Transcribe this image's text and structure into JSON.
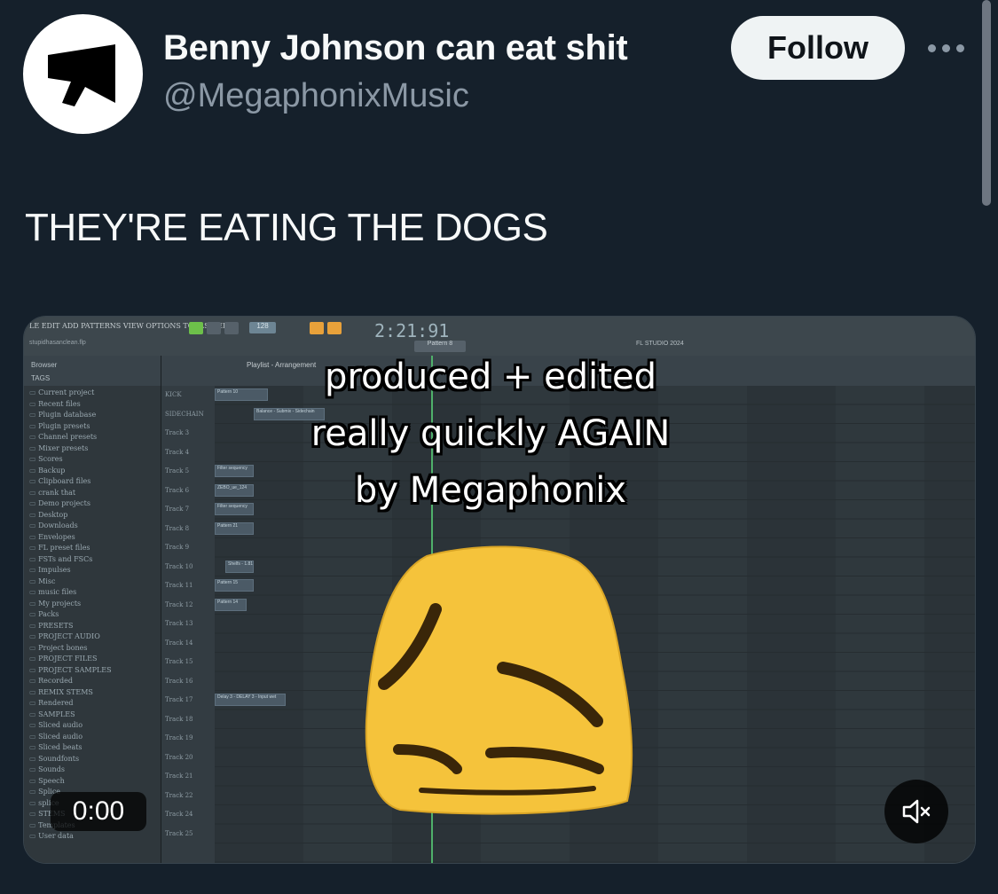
{
  "tweet": {
    "author": {
      "display_name": "Benny Johnson can eat shit",
      "handle": "@MegaphonixMusic",
      "avatar_icon": "megaphone-icon"
    },
    "follow_label": "Follow",
    "more_icon": "more-horizontal-icon",
    "text": "THEY'RE EATING THE DOGS"
  },
  "video": {
    "caption_lines": [
      "produced + edited",
      "really quickly AGAIN",
      "by Megaphonix"
    ],
    "time": "0:00",
    "mute_icon": "volume-muted-icon",
    "app": {
      "menu": "LE EDIT ADD PATTERNS VIEW OPTIONS TOOLS HELP",
      "project": "stupidhasanclean.flp",
      "time": "2:21:91",
      "bpm": "128",
      "pattern": "Pattern 8",
      "studio_tag": "FL STUDIO 2024",
      "playlist_title": "Playlist - Arrangement",
      "browser_head": "Browser",
      "browser_tags": "TAGS",
      "browser_items": [
        "Current project",
        "Recent files",
        "Plugin database",
        "Plugin presets",
        "Channel presets",
        "Mixer presets",
        "Scores",
        "Backup",
        "Clipboard files",
        "crank that",
        "Demo projects",
        "Desktop",
        "Downloads",
        "Envelopes",
        "FL preset files",
        "FSTs and FSCs",
        "Impulses",
        "Misc",
        "music files",
        "My projects",
        "Packs",
        "PRESETS",
        "PROJECT AUDIO",
        "Project bones",
        "PROJECT FILES",
        "PROJECT SAMPLES",
        "Recorded",
        "REMIX STEMS",
        "Rendered",
        "SAMPLES",
        "Sliced audio",
        "Sliced audio",
        "Sliced beats",
        "Soundfonts",
        "Sounds",
        "Speech",
        "Splice",
        "splice",
        "STEMS",
        "Templates",
        "User data"
      ],
      "tracks": [
        "KICK",
        "SIDECHAIN",
        "Track 3",
        "Track 4",
        "Track 5",
        "Track 6",
        "Track 7",
        "Track 8",
        "Track 9",
        "Track 10",
        "Track 11",
        "Track 12",
        "Track 13",
        "Track 14",
        "Track 15",
        "Track 16",
        "Track 17",
        "Track 18",
        "Track 19",
        "Track 20",
        "Track 21",
        "Track 22",
        "Track 24",
        "Track 25"
      ],
      "clips": [
        "Pattern 10",
        "Balance - Submix - Sidechain",
        "Filter sequency",
        "ZEBO_ue_124",
        "Filter sequency",
        "Pattern 21",
        "Shelfs - 1.81",
        "Pattern 15",
        "Pattern 14",
        "Delay 3 - DELAY 3 - Input wet"
      ]
    }
  },
  "colors": {
    "background": "#15202b",
    "text_primary": "#f7f9f9",
    "text_secondary": "#8b98a5",
    "follow_bg": "#eff3f4",
    "emoji_yellow": "#f5c33b"
  }
}
